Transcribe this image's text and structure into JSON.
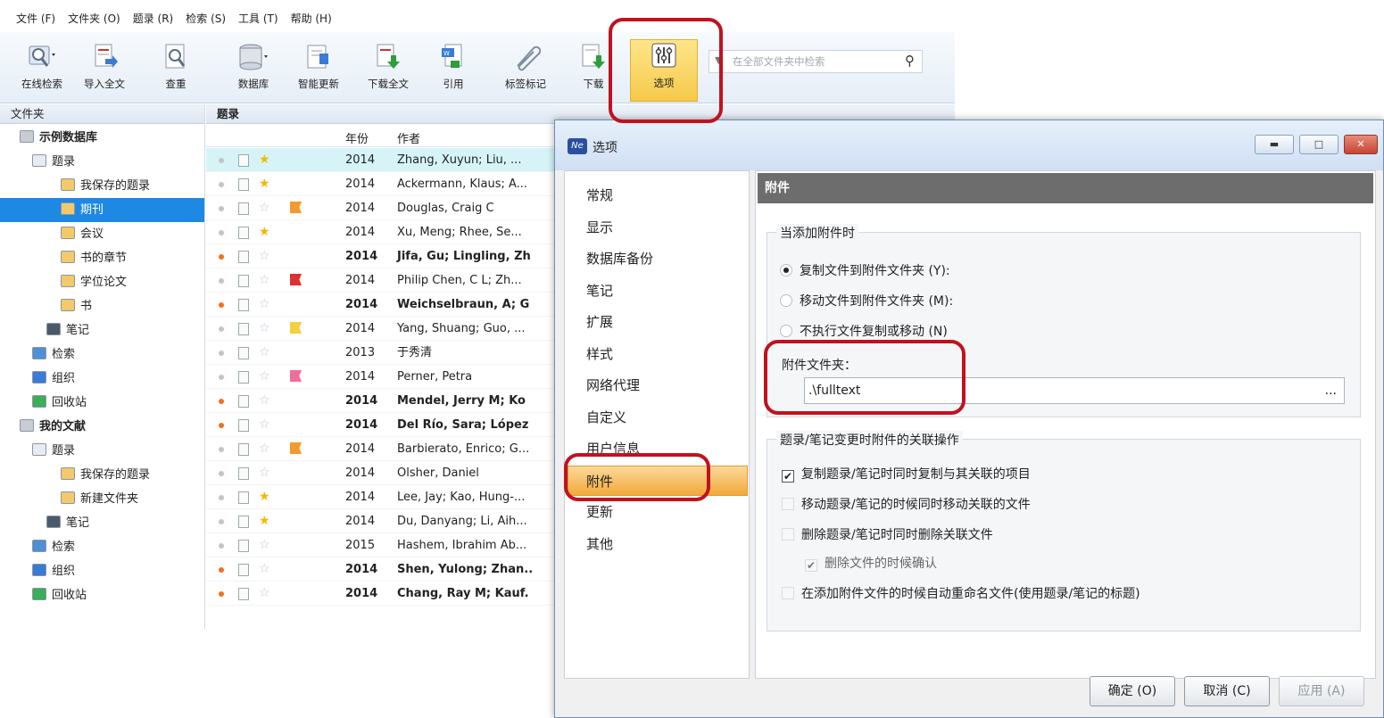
{
  "menubar": {
    "items": [
      "文件 (F)",
      "文件夹 (O)",
      "题录 (R)",
      "检索 (S)",
      "工具 (T)",
      "帮助 (H)"
    ]
  },
  "toolbar": {
    "buttons": [
      "在线检索",
      "导入全文",
      "查重",
      "数据库",
      "智能更新",
      "下载全文",
      "引用",
      "标签标记",
      "下载"
    ],
    "options_label": "选项",
    "search_placeholder": "在全部文件夹中检索"
  },
  "folder_pane": {
    "header": "文件夹",
    "items": [
      {
        "label": "示例数据库",
        "icon": "database-icon"
      },
      {
        "label": "题录",
        "icon": "references-icon"
      },
      {
        "label": "我保存的题录",
        "icon": "folder-icon"
      },
      {
        "label": "期刊",
        "icon": "folder-icon"
      },
      {
        "label": "会议",
        "icon": "folder-icon"
      },
      {
        "label": "书的章节",
        "icon": "folder-icon"
      },
      {
        "label": "学位论文",
        "icon": "folder-icon"
      },
      {
        "label": "书",
        "icon": "folder-icon"
      },
      {
        "label": "笔记",
        "icon": "notes-icon"
      },
      {
        "label": "检索",
        "icon": "search-icon"
      },
      {
        "label": "组织",
        "icon": "organize-icon"
      },
      {
        "label": "回收站",
        "icon": "recycle-bin-icon"
      },
      {
        "label": "我的文献",
        "icon": "database-icon"
      },
      {
        "label": "题录",
        "icon": "references-icon"
      },
      {
        "label": "我保存的题录",
        "icon": "folder-icon"
      },
      {
        "label": "新建文件夹",
        "icon": "folder-icon"
      },
      {
        "label": "笔记",
        "icon": "notes-icon"
      },
      {
        "label": "检索",
        "icon": "search-icon"
      },
      {
        "label": "组织",
        "icon": "organize-icon"
      },
      {
        "label": "回收站",
        "icon": "recycle-bin-icon"
      }
    ],
    "selected_index": 3
  },
  "ref_pane": {
    "header": "题录",
    "columns": {
      "year": "年份",
      "author": "作者"
    },
    "rows": [
      {
        "year": "2014",
        "author": "Zhang, Xuyun; Liu, ...",
        "dot": "grey",
        "star": true,
        "flag": "",
        "bold": false
      },
      {
        "year": "2014",
        "author": "Ackermann, Klaus; A...",
        "dot": "grey",
        "star": true,
        "flag": "",
        "bold": false
      },
      {
        "year": "2014",
        "author": "Douglas, Craig C",
        "dot": "grey",
        "star": false,
        "flag": "orange",
        "bold": false
      },
      {
        "year": "2014",
        "author": "Xu, Meng; Rhee, Se...",
        "dot": "grey",
        "star": true,
        "flag": "",
        "bold": false
      },
      {
        "year": "2014",
        "author": "Jifa, Gu; Lingling, Zh",
        "dot": "orange",
        "star": false,
        "flag": "",
        "bold": true
      },
      {
        "year": "2014",
        "author": "Philip Chen, C L; Zh...",
        "dot": "grey",
        "star": false,
        "flag": "red",
        "bold": false
      },
      {
        "year": "2014",
        "author": "Weichselbraun, A; G",
        "dot": "orange",
        "star": false,
        "flag": "",
        "bold": true
      },
      {
        "year": "2014",
        "author": "Yang, Shuang; Guo, ...",
        "dot": "grey",
        "star": false,
        "flag": "yellow",
        "bold": false
      },
      {
        "year": "2013",
        "author": "于秀清",
        "dot": "grey",
        "star": false,
        "flag": "",
        "bold": false
      },
      {
        "year": "2014",
        "author": "Perner, Petra",
        "dot": "grey",
        "star": false,
        "flag": "pink",
        "bold": false
      },
      {
        "year": "2014",
        "author": "Mendel, Jerry M; Ko",
        "dot": "orange",
        "star": false,
        "flag": "",
        "bold": true
      },
      {
        "year": "2014",
        "author": "Del Río, Sara; López",
        "dot": "orange",
        "star": false,
        "flag": "",
        "bold": true
      },
      {
        "year": "2014",
        "author": "Barbierato, Enrico; G...",
        "dot": "grey",
        "star": false,
        "flag": "orange",
        "bold": false
      },
      {
        "year": "2014",
        "author": "Olsher, Daniel",
        "dot": "grey",
        "star": false,
        "flag": "",
        "bold": false
      },
      {
        "year": "2014",
        "author": "Lee, Jay; Kao, Hung-...",
        "dot": "grey",
        "star": true,
        "flag": "",
        "bold": false
      },
      {
        "year": "2014",
        "author": "Du, Danyang; Li, Aih...",
        "dot": "grey",
        "star": true,
        "flag": "",
        "bold": false
      },
      {
        "year": "2015",
        "author": "Hashem, Ibrahim Ab...",
        "dot": "grey",
        "star": false,
        "flag": "",
        "bold": false
      },
      {
        "year": "2014",
        "author": "Shen, Yulong; Zhan..",
        "dot": "orange",
        "star": false,
        "flag": "",
        "bold": true
      },
      {
        "year": "2014",
        "author": "Chang, Ray M; Kauf.",
        "dot": "orange",
        "star": false,
        "flag": "",
        "bold": true
      }
    ]
  },
  "dialog": {
    "logo": "Ne",
    "title": "选项",
    "nav": [
      "常规",
      "显示",
      "数据库备份",
      "笔记",
      "扩展",
      "样式",
      "网络代理",
      "自定义",
      "用户信息",
      "附件",
      "更新",
      "其他"
    ],
    "nav_selected_index": 9,
    "section_title": "附件",
    "group1": {
      "title": "当添加附件时",
      "options": [
        {
          "label": "复制文件到附件文件夹 (Y):",
          "checked": true
        },
        {
          "label": "移动文件到附件文件夹 (M):",
          "checked": false
        },
        {
          "label": "不执行文件复制或移动 (N)",
          "checked": false
        }
      ],
      "folder_label": "附件文件夹：",
      "folder_value": ".\\fulltext",
      "browse": "..."
    },
    "group2": {
      "title": "题录/笔记变更时附件的关联操作",
      "options": [
        {
          "label": "复制题录/笔记时同时复制与其关联的项目",
          "checked": true,
          "enabled": true
        },
        {
          "label": "移动题录/笔记的时候同时移动关联的文件",
          "checked": false,
          "enabled": true
        },
        {
          "label": "删除题录/笔记时同时删除关联文件",
          "checked": false,
          "enabled": true
        },
        {
          "label": "删除文件的时候确认",
          "checked": true,
          "enabled": false
        },
        {
          "label": "在添加附件文件的时候自动重命名文件(使用题录/笔记的标题)",
          "checked": false,
          "enabled": true
        }
      ]
    },
    "buttons": {
      "ok": "确定 (O)",
      "cancel": "取消 (C)",
      "apply": "应用 (A)"
    }
  },
  "colors": {
    "highlight": "#c0121e",
    "selection": "#1e88e5",
    "accent": "#f2a93a"
  }
}
